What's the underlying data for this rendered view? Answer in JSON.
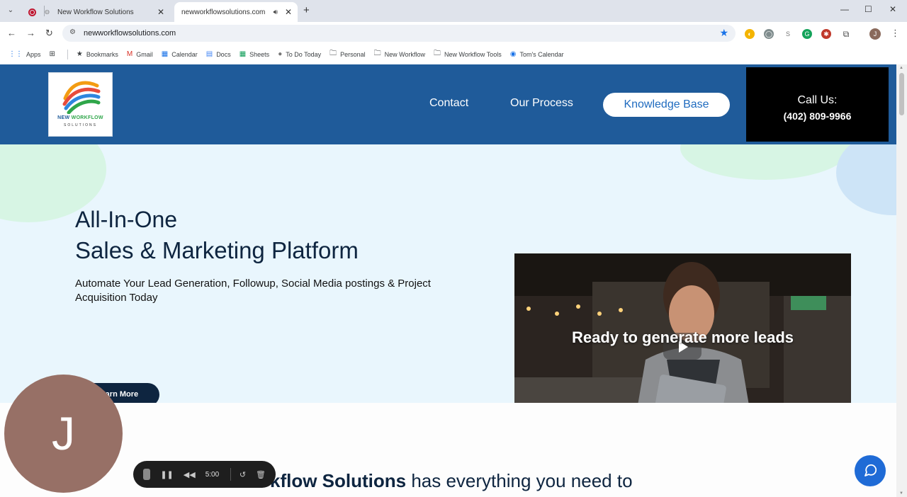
{
  "browser": {
    "tabs": [
      {
        "title": "New Workflow Solutions",
        "active": false
      },
      {
        "title": "newworkflowsolutions.com",
        "active": true
      }
    ],
    "url": "newworkflowsolutions.com",
    "profile_initial": "J",
    "bookmarks": [
      {
        "label": "Apps",
        "icon": "apps-grid-icon"
      },
      {
        "label": "Bookmarks",
        "icon": "star-icon"
      },
      {
        "label": "Gmail",
        "icon": "gmail-icon"
      },
      {
        "label": "Calendar",
        "icon": "calendar-icon"
      },
      {
        "label": "Docs",
        "icon": "docs-icon"
      },
      {
        "label": "Sheets",
        "icon": "sheets-icon"
      },
      {
        "label": "To Do Today",
        "icon": "apple-icon"
      },
      {
        "label": "Personal",
        "icon": "folder-icon"
      },
      {
        "label": "New Workflow",
        "icon": "folder-icon"
      },
      {
        "label": "New Workflow Tools",
        "icon": "folder-icon"
      },
      {
        "label": "Tom's Calendar",
        "icon": "circle-icon"
      }
    ]
  },
  "site": {
    "logo": {
      "line1_a": "NEW ",
      "line1_b": "WORKFLOW",
      "line2": "SOLUTIONS"
    },
    "nav": {
      "contact": "Contact",
      "process": "Our Process",
      "knowledge": "Knowledge Base"
    },
    "call": {
      "label": "Call Us:",
      "phone": "(402) 809-9966"
    },
    "hero": {
      "title1": "All-In-One",
      "title2": "Sales & Marketing Platform",
      "subtitle": "Automate Your Lead Generation, Followup, Social Media postings & Project Acquisition Today",
      "cta": "Learn More",
      "video_text": "Ready to generate more leads"
    },
    "lower": {
      "bold": "orkflow Solutions",
      "rest": " has everything you need to"
    }
  },
  "recorder": {
    "avatar_initial": "J",
    "time": "5:00"
  },
  "colors": {
    "header": "#1f5b9a",
    "hero_bg": "#e9f6fd",
    "navy": "#0e2540",
    "chat": "#1f6bd6"
  }
}
